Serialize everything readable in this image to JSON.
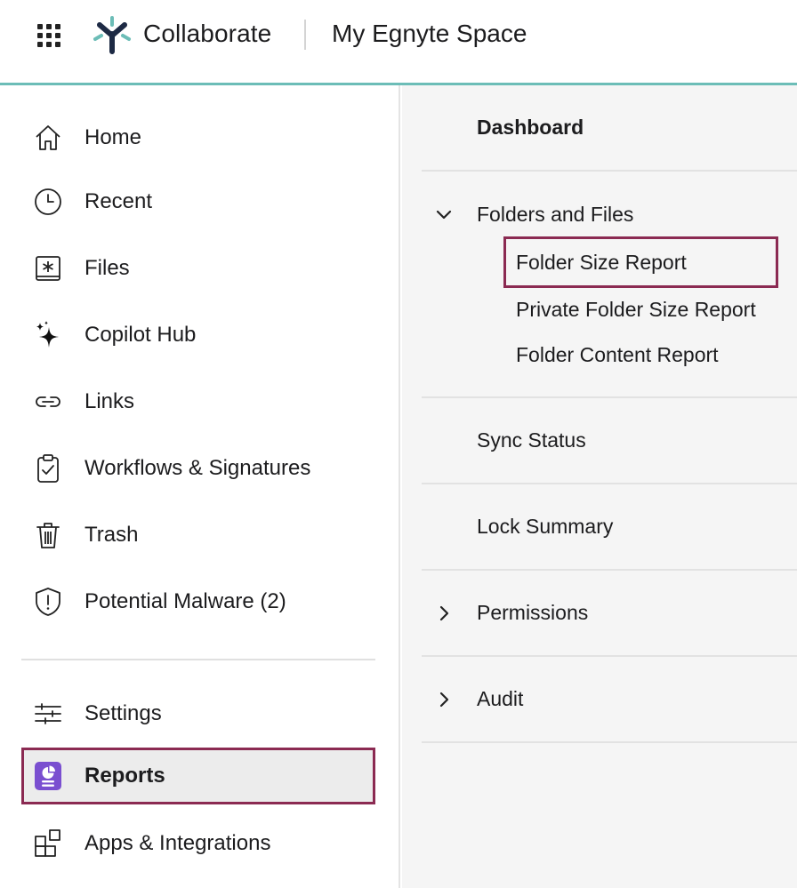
{
  "header": {
    "brand": "Collaborate",
    "space_title": "My Egnyte Space",
    "apps_icon": "apps-grid-icon",
    "logo_icon": "egnyte-logo-icon",
    "accent_color": "#6cbdb7"
  },
  "sidebar": {
    "items": [
      {
        "label": "Home",
        "icon": "home-icon"
      },
      {
        "label": "Recent",
        "icon": "clock-icon"
      },
      {
        "label": "Files",
        "icon": "files-icon"
      },
      {
        "label": "Copilot Hub",
        "icon": "sparkle-icon"
      },
      {
        "label": "Links",
        "icon": "link-icon"
      },
      {
        "label": "Workflows & Signatures",
        "icon": "clipboard-check-icon"
      },
      {
        "label": "Trash",
        "icon": "trash-icon"
      },
      {
        "label": "Potential Malware (2)",
        "icon": "shield-alert-icon"
      }
    ],
    "bottom_items": [
      {
        "label": "Settings",
        "icon": "sliders-icon"
      },
      {
        "label": "Reports",
        "icon": "reports-icon",
        "active": true,
        "icon_color": "#7a4fd0"
      },
      {
        "label": "Apps & Integrations",
        "icon": "apps-integrations-icon"
      }
    ],
    "highlight_color": "#8b2a52"
  },
  "reports": {
    "dashboard": "Dashboard",
    "folders_and_files": {
      "label": "Folders and Files",
      "expanded": true,
      "children": [
        "Folder Size Report",
        "Private Folder Size Report",
        "Folder Content Report"
      ],
      "highlighted_child": "Folder Size Report"
    },
    "sync_status": "Sync Status",
    "lock_summary": "Lock Summary",
    "permissions": {
      "label": "Permissions",
      "expanded": false
    },
    "audit": {
      "label": "Audit",
      "expanded": false
    }
  }
}
